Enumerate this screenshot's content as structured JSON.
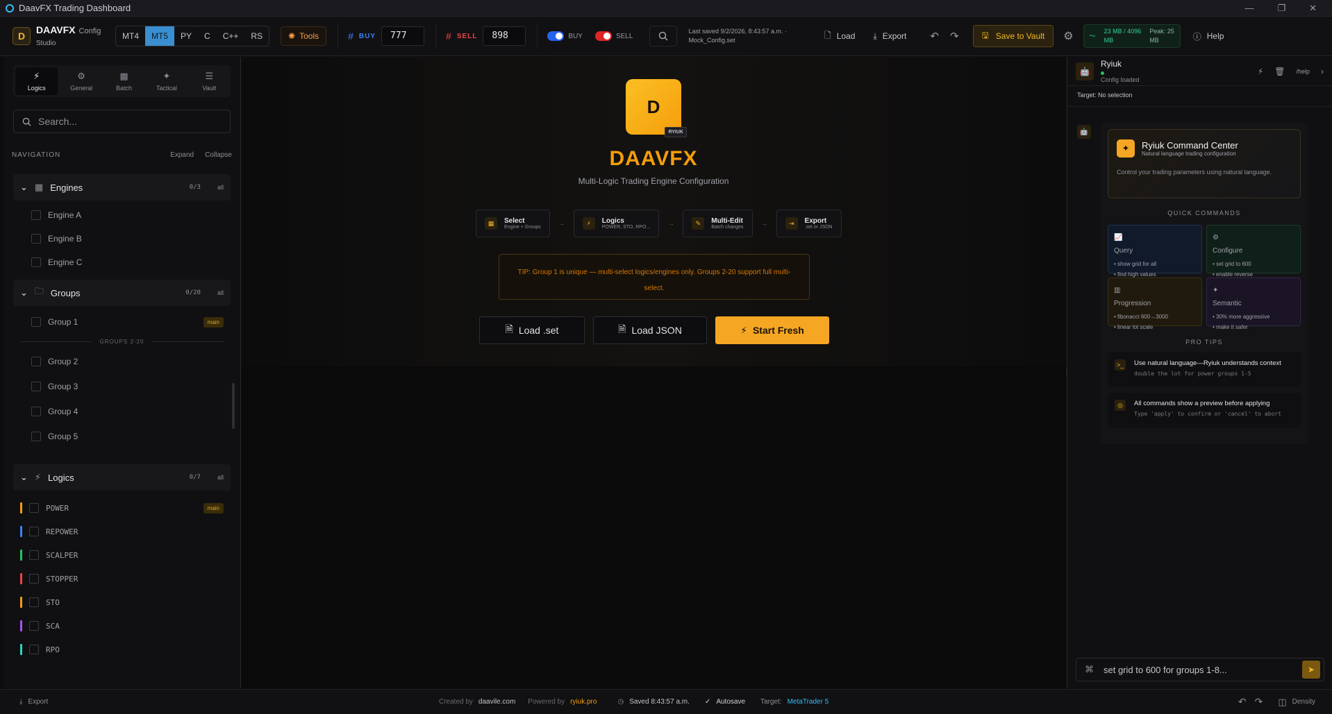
{
  "window": {
    "title": "DaavFX Trading Dashboard",
    "controls": [
      "—",
      "❐",
      "✕"
    ]
  },
  "brand": {
    "logo_letter": "D",
    "name": "DAAVFX",
    "config": "Config",
    "studio": "Studio"
  },
  "platforms": [
    {
      "label": "MT4",
      "active": false
    },
    {
      "label": "MT5",
      "active": true
    },
    {
      "label": "PY",
      "active": false
    },
    {
      "label": "C",
      "active": false
    },
    {
      "label": "C++",
      "active": false
    },
    {
      "label": "RS",
      "active": false
    }
  ],
  "tools_label": "Tools",
  "magic": {
    "buy_label": "BUY",
    "buy_value": "777",
    "buy_color": "#3b82f6",
    "sell_label": "SELL",
    "sell_value": "898",
    "sell_color": "#ef4444"
  },
  "toggles": {
    "buy": "BUY",
    "sell": "SELL"
  },
  "last_saved": {
    "line1": "Last saved 9/2/2026, 8:43:57 a.m. ·",
    "line2": "Mock_Config.set"
  },
  "toolbar": {
    "load": "Load",
    "export": "Export",
    "save_vault": "Save to Vault",
    "help": "Help"
  },
  "memory": {
    "usage": "23 MB / 4096",
    "unit": "MB",
    "peak": "Peak: 25",
    "peak_unit": "MB"
  },
  "sidebar": {
    "tabs": [
      {
        "label": "Logics",
        "icon": "⚡",
        "active": true
      },
      {
        "label": "General",
        "icon": "⚙",
        "active": false
      },
      {
        "label": "Batch",
        "icon": "▦",
        "active": false
      },
      {
        "label": "Tactical",
        "icon": "✦",
        "active": false
      },
      {
        "label": "Vault",
        "icon": "☰",
        "active": false
      }
    ],
    "search_placeholder": "Search...",
    "nav_label": "NAVIGATION",
    "expand": "Expand",
    "collapse": "Collapse",
    "engines": {
      "title": "Engines",
      "count": "0/3",
      "all": "all",
      "items": [
        "Engine A",
        "Engine B",
        "Engine C"
      ]
    },
    "groups": {
      "title": "Groups",
      "count": "0/20",
      "all": "all",
      "group1": "Group 1",
      "main_badge": "main",
      "divider": "GROUPS 2-20",
      "items": [
        "Group 2",
        "Group 3",
        "Group 4",
        "Group 5"
      ]
    },
    "logics": {
      "title": "Logics",
      "count": "0/7",
      "all": "all",
      "main_badge": "main",
      "items": [
        {
          "label": "POWER",
          "color": "#f59e0b"
        },
        {
          "label": "REPOWER",
          "color": "#3b82f6"
        },
        {
          "label": "SCALPER",
          "color": "#22c55e"
        },
        {
          "label": "STOPPER",
          "color": "#ef4444"
        },
        {
          "label": "STO",
          "color": "#f59e0b"
        },
        {
          "label": "SCA",
          "color": "#a855f7"
        },
        {
          "label": "RPO",
          "color": "#2dd4bf"
        }
      ]
    }
  },
  "hero": {
    "logo_letter": "D",
    "logo_tag": "RYIUK",
    "title": "DAAVFX",
    "subtitle": "Multi-Logic Trading Engine Configuration",
    "steps": [
      {
        "title": "Select",
        "desc": "Engine + Groups"
      },
      {
        "title": "Logics",
        "desc": "POWER, STO, RPO..."
      },
      {
        "title": "Multi-Edit",
        "desc": "Batch changes"
      },
      {
        "title": "Export",
        "desc": ".set or JSON"
      }
    ],
    "tip": "TIP: Group 1 is unique — multi-select logics/engines only. Groups 2-20 support full multi-select.",
    "btn_load_set": "Load .set",
    "btn_load_json": "Load JSON",
    "btn_start": "Start Fresh"
  },
  "ryiuk": {
    "name": "Ryiuk",
    "status": "Config loaded",
    "help_cmd": "/help",
    "target": "Target: No selection",
    "cc_title": "Ryiuk Command Center",
    "cc_sub": "Natural language trading configuration",
    "cc_desc": "Control your trading parameters using natural language.",
    "quick_label": "QUICK COMMANDS",
    "quick": [
      {
        "title": "Query",
        "l1": "• show grid for all",
        "l2": "• find high values",
        "color": "#60a5fa",
        "bg": "#111a2a",
        "border": "#1e3050"
      },
      {
        "title": "Configure",
        "l1": "• set grid to 600",
        "l2": "• enable reverse",
        "color": "#34d399",
        "bg": "#0f1f19",
        "border": "#1d3a2b"
      },
      {
        "title": "Progression",
        "l1": "• fibonacci 600→3000",
        "l2": "• linear lot scale",
        "color": "#fbbf24",
        "bg": "#1f1a0d",
        "border": "#3b3016"
      },
      {
        "title": "Semantic",
        "l1": "• 30% more aggressive",
        "l2": "• make it safer",
        "color": "#c084fc",
        "bg": "#1a1424",
        "border": "#33264a"
      }
    ],
    "pro_label": "PRO TIPS",
    "pro": [
      {
        "title": "Use natural language—Ryiuk understands context",
        "sub": "double the lot for power groups 1-5"
      },
      {
        "title": "All commands show a preview before applying",
        "sub": "Type 'apply' to confirm or 'cancel' to abort"
      }
    ],
    "input_value": "set grid to 600 for groups 1-8..."
  },
  "footer": {
    "export": "Export",
    "created_by": "Created by",
    "creator": "daavile.com",
    "powered_by": "Powered by",
    "power": "ryiuk.pro",
    "saved": "Saved 8:43:57 a.m.",
    "autosave": "Autosave",
    "target_label": "Target:",
    "target": "MetaTrader 5",
    "density": "Density"
  }
}
